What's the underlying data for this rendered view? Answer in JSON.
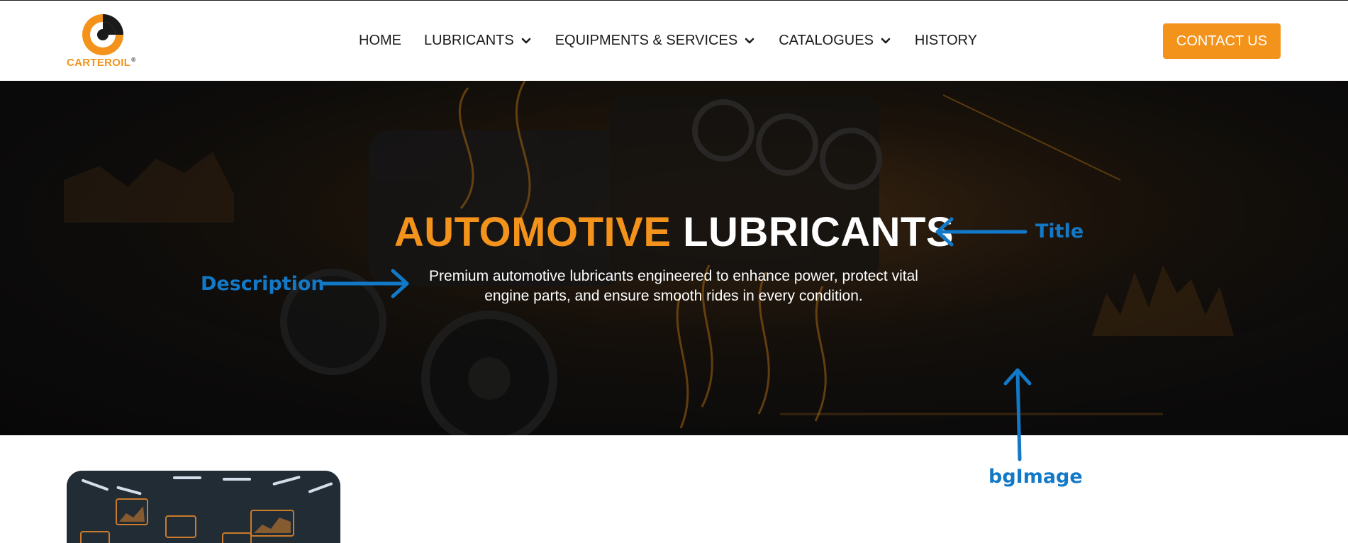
{
  "brand": {
    "name": "CARTEROIL",
    "registered_mark": "®",
    "accent_color": "#f3931b",
    "annotation_color": "#1279c9"
  },
  "nav": {
    "items": [
      {
        "label": "HOME",
        "has_dropdown": false
      },
      {
        "label": "LUBRICANTS",
        "has_dropdown": true
      },
      {
        "label": "EQUIPMENTS & SERVICES",
        "has_dropdown": true
      },
      {
        "label": "CATALOGUES",
        "has_dropdown": true
      },
      {
        "label": "HISTORY",
        "has_dropdown": false
      }
    ],
    "dropdown_icon": "chevron-down-icon"
  },
  "contact": {
    "label": "CONTACT US"
  },
  "hero": {
    "title_accent": "AUTOMOTIVE",
    "title_main": "LUBRICANTS",
    "description": "Premium automotive lubricants engineered to enhance power, protect vital engine parts, and ensure smooth rides in every condition."
  },
  "annotations": {
    "title": "Title",
    "description": "Description",
    "bg_image": "bgImage"
  }
}
